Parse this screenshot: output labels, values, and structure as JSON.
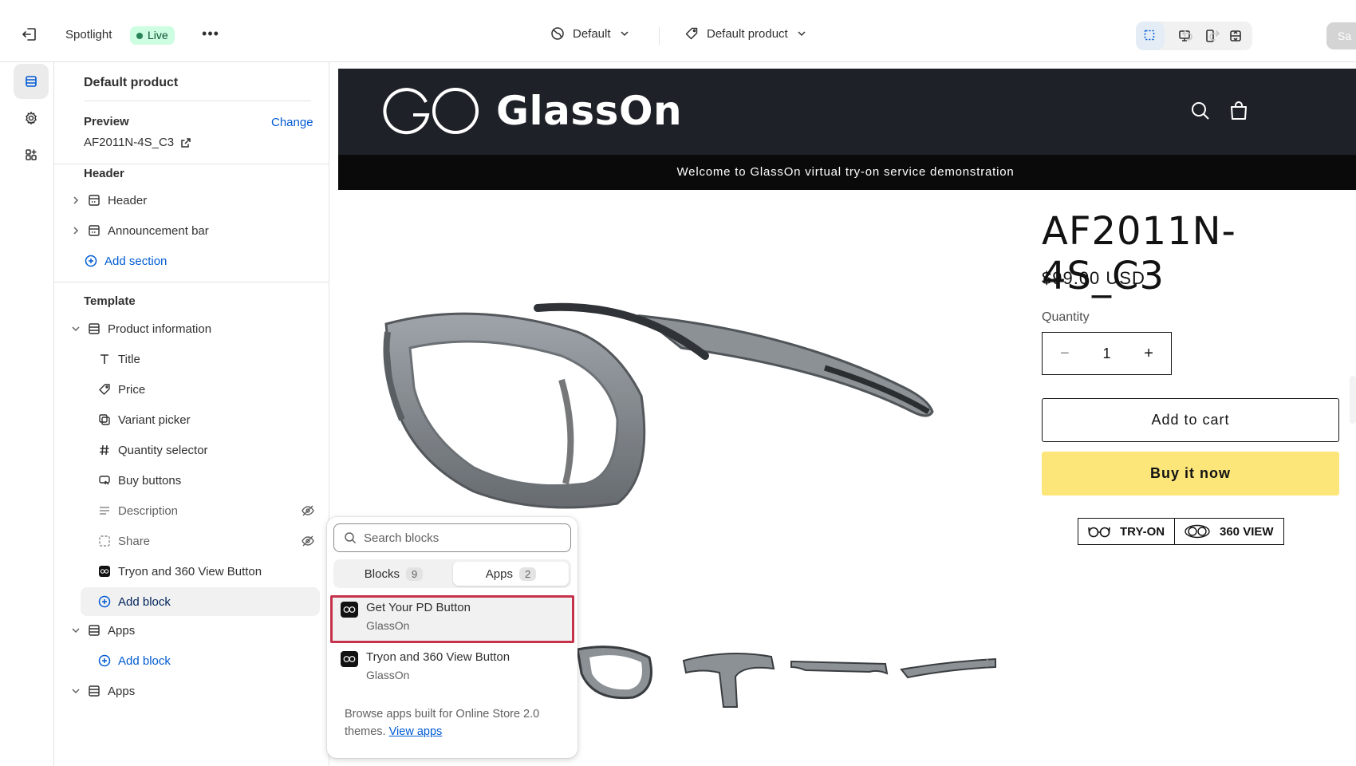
{
  "topbar": {
    "store_name": "Spotlight",
    "status_badge": "Live",
    "theme_dropdown": "Default",
    "template_dropdown": "Default product",
    "save_label": "Sa"
  },
  "sidebar": {
    "title": "Default product",
    "preview_label": "Preview",
    "change_label": "Change",
    "preview_product": "AF2011N-4S_C3",
    "header_section": {
      "title": "Header",
      "items": [
        "Header",
        "Announcement bar"
      ],
      "add_label": "Add section"
    },
    "template_section": {
      "title": "Template",
      "group_label": "Product information",
      "blocks": [
        {
          "label": "Title",
          "icon": "text-icon"
        },
        {
          "label": "Price",
          "icon": "price-tag-icon"
        },
        {
          "label": "Variant picker",
          "icon": "variant-icon"
        },
        {
          "label": "Quantity selector",
          "icon": "hash-icon"
        },
        {
          "label": "Buy buttons",
          "icon": "cart-icon"
        },
        {
          "label": "Description",
          "icon": "paragraph-icon",
          "hidden": true
        },
        {
          "label": "Share",
          "icon": "share-icon",
          "hidden": true
        },
        {
          "label": "Tryon and 360 View Button",
          "icon": "glasson-app-icon"
        }
      ],
      "add_block_label": "Add block",
      "apps_label": "Apps",
      "apps_add_block_label": "Add block",
      "apps2_label": "Apps"
    }
  },
  "storefront": {
    "brand": "GlassOn",
    "announcement": "Welcome to GlassOn virtual try-on service demonstration",
    "product_title": "AF2011N-4S_C3",
    "price": "$99.00 USD",
    "quantity_label": "Quantity",
    "quantity_value": "1",
    "add_to_cart": "Add to cart",
    "buy_now": "Buy it now",
    "tryon_label": "TRY-ON",
    "view360_label": "360 VIEW"
  },
  "block_picker": {
    "search_placeholder": "Search blocks",
    "tabs": [
      {
        "label": "Blocks",
        "count": "9"
      },
      {
        "label": "Apps",
        "count": "2"
      }
    ],
    "items": [
      {
        "name": "Get Your PD Button",
        "app": "GlassOn",
        "selected": true
      },
      {
        "name": "Tryon and 360 View Button",
        "app": "GlassOn",
        "selected": false
      }
    ],
    "browse_text": "Browse apps built for Online Store 2.0 themes.",
    "browse_link": "View apps"
  },
  "colors": {
    "accent_blue": "#005bd3",
    "live_badge_bg": "#cdfee1",
    "store_header_bg": "#1f2128",
    "buy_now_bg": "#fce67a",
    "selection_outline": "#c4334b"
  }
}
